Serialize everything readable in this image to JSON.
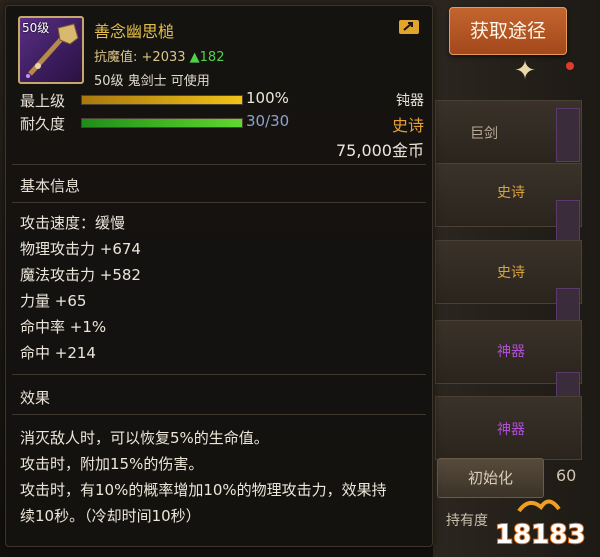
{
  "item": {
    "level_badge": "50级",
    "name": "善念幽思槌",
    "resist_label": "抗魔值:",
    "resist_value": "+2033",
    "resist_delta": "▲182",
    "requirement": "50级 鬼剑士 可使用",
    "type": "钝器",
    "rarity": "史诗",
    "price": "75,000金币"
  },
  "bars": {
    "top_grade": {
      "label": "最上级",
      "value": "100%",
      "fraction": 1.0
    },
    "durability": {
      "label": "耐久度",
      "value": "30/30",
      "fraction": 1.0
    }
  },
  "basic": {
    "title": "基本信息",
    "stats": [
      "攻击速度：缓慢",
      "物理攻击力 +674",
      "魔法攻击力 +582",
      "力量 +65",
      "命中率 +1%",
      "命中 +214"
    ]
  },
  "effect": {
    "title": "效果",
    "lines": [
      "消灭敌人时，可以恢复5%的生命值。",
      "攻击时，附加15%的伤害。",
      "攻击时，有10%的概率增加10%的物理攻击力，效果持",
      "续10秒。（冷却时间10秒）"
    ]
  },
  "background": {
    "get_button": "获取途径",
    "row_labels": [
      "巨剑",
      "史诗",
      "史诗",
      "神器",
      "神器"
    ],
    "init_button": "初始化",
    "bottom_label": "持有度",
    "side_number": "60",
    "logo_text": "18183"
  },
  "colors": {
    "epic": "#e5a13a",
    "name": "#e2bf4a",
    "positive": "#4fd14a",
    "divine": "#b04fd6"
  },
  "icons": [
    "share-icon",
    "sparkle-icon",
    "notification-dot-icon",
    "mace-item-icon"
  ]
}
